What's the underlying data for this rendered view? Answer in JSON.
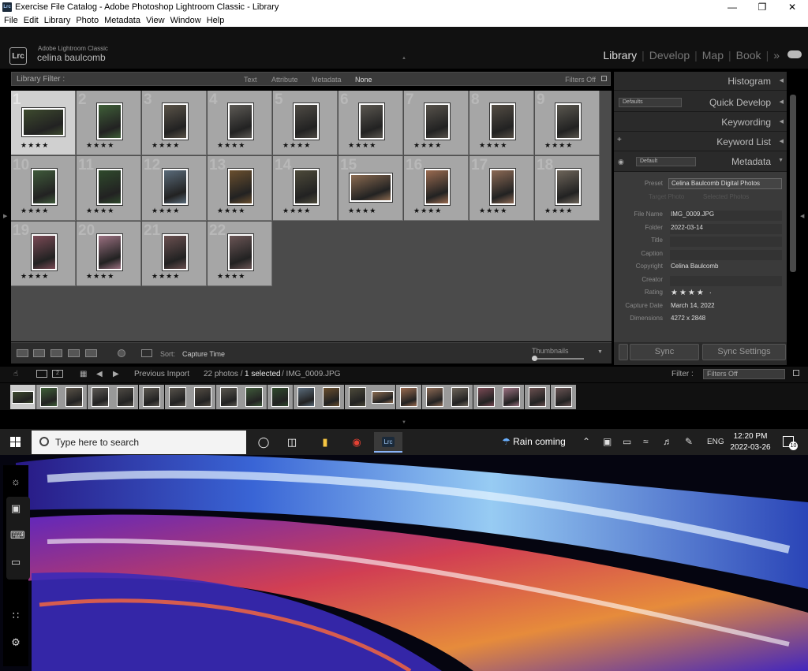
{
  "window": {
    "title": "Exercise File Catalog - Adobe Photoshop Lightroom Classic - Library",
    "icon_label": "Lrc",
    "minimize_icon": "minimize-icon",
    "maximize_icon": "restore-icon",
    "close_icon": "close-icon"
  },
  "menu": [
    "File",
    "Edit",
    "Library",
    "Photo",
    "Metadata",
    "View",
    "Window",
    "Help"
  ],
  "identity": {
    "logo": "Lrc",
    "product": "Adobe Lightroom Classic",
    "user": "celina baulcomb"
  },
  "modules": [
    "Library",
    "Develop",
    "Map",
    "Book"
  ],
  "modules_more": "»",
  "filter": {
    "label": "Library Filter :",
    "options": [
      "Text",
      "Attribute",
      "Metadata",
      "None"
    ],
    "active": "None",
    "status": "Filters Off"
  },
  "grid": {
    "photos": [
      {
        "n": "1",
        "stars": "★★★★",
        "orient": "land",
        "color": "#3d4a2e",
        "sel": true
      },
      {
        "n": "2",
        "stars": "★★★★",
        "orient": "port",
        "color": "#3f5f38"
      },
      {
        "n": "3",
        "stars": "★★★★",
        "orient": "port",
        "color": "#5a5348"
      },
      {
        "n": "4",
        "stars": "★★★★",
        "orient": "port",
        "color": "#5d5a55"
      },
      {
        "n": "5",
        "stars": "★★★★",
        "orient": "port",
        "color": "#4f4b45"
      },
      {
        "n": "6",
        "stars": "★★★★",
        "orient": "port",
        "color": "#5b5750"
      },
      {
        "n": "7",
        "stars": "★★★★",
        "orient": "port",
        "color": "#57524b"
      },
      {
        "n": "8",
        "stars": "★★★★",
        "orient": "port",
        "color": "#544d44"
      },
      {
        "n": "9",
        "stars": "★★★★",
        "orient": "port",
        "color": "#5a574f"
      },
      {
        "n": "10",
        "stars": "★★★★",
        "orient": "port",
        "color": "#3f5a3a"
      },
      {
        "n": "11",
        "stars": "★★★★",
        "orient": "port",
        "color": "#2f4a2c"
      },
      {
        "n": "12",
        "stars": "★★★★",
        "orient": "port",
        "color": "#5a6b7a"
      },
      {
        "n": "13",
        "stars": "★★★★",
        "orient": "port",
        "color": "#6a4f2e"
      },
      {
        "n": "14",
        "stars": "★★★★",
        "orient": "port",
        "color": "#4d4a3a"
      },
      {
        "n": "15",
        "stars": "★★★★",
        "orient": "land",
        "color": "#8a6a50"
      },
      {
        "n": "16",
        "stars": "★★★★",
        "orient": "port",
        "color": "#9a6b50"
      },
      {
        "n": "17",
        "stars": "★★★★",
        "orient": "port",
        "color": "#8c6a55"
      },
      {
        "n": "18",
        "stars": "★★★★",
        "orient": "port",
        "color": "#6e655a"
      },
      {
        "n": "19",
        "stars": "★★★★",
        "orient": "port",
        "color": "#7a4a55"
      },
      {
        "n": "20",
        "stars": "★★★★",
        "orient": "port",
        "color": "#9a7080"
      },
      {
        "n": "21",
        "stars": "★★★★",
        "orient": "port",
        "color": "#6a5050"
      },
      {
        "n": "22",
        "stars": "★★★★",
        "orient": "port",
        "color": "#6a5555"
      }
    ]
  },
  "toolbar": {
    "sort_label": "Sort:",
    "sort_value": "Capture Time",
    "thumbnails": "Thumbnails"
  },
  "panels": {
    "histogram": "Histogram",
    "quick_develop": "Quick Develop",
    "quick_develop_preset": "Defaults",
    "keywording": "Keywording",
    "keyword_list": "Keyword List",
    "keyword_plus": "+",
    "metadata": "Metadata",
    "metadata_preset": "Default",
    "preset_label": "Preset",
    "preset_value": "Celina Baulcomb Digital Photos",
    "target_photo": "Target Photo",
    "selected_photos": "Selected Photos",
    "fields": [
      {
        "label": "File Name",
        "value": "IMG_0009.JPG"
      },
      {
        "label": "Folder",
        "value": "2022-03-14"
      },
      {
        "label": "Title",
        "value": ""
      },
      {
        "label": "Caption",
        "value": ""
      },
      {
        "label": "Copyright",
        "value": "Celina Baulcomb"
      },
      {
        "label": "Creator",
        "value": ""
      },
      {
        "label": "Rating",
        "value": "★★★★ ·"
      },
      {
        "label": "Capture Date",
        "value": "March 14, 2022"
      },
      {
        "label": "Dimensions",
        "value": "4272 x 2848"
      }
    ],
    "sync": "Sync",
    "sync_settings": "Sync Settings"
  },
  "filmstrip": {
    "source": "Previous Import",
    "count": "22 photos /",
    "selected": "1 selected",
    "file": "/ IMG_0009.JPG",
    "filter_label": "Filter :",
    "filter_value": "Filters Off"
  },
  "taskbar": {
    "search_placeholder": "Type here to search",
    "app_lrc": "Lrc",
    "weather": "Rain coming",
    "lang": "ENG",
    "time": "12:20 PM",
    "date": "2022-03-26",
    "notifications": "10"
  }
}
